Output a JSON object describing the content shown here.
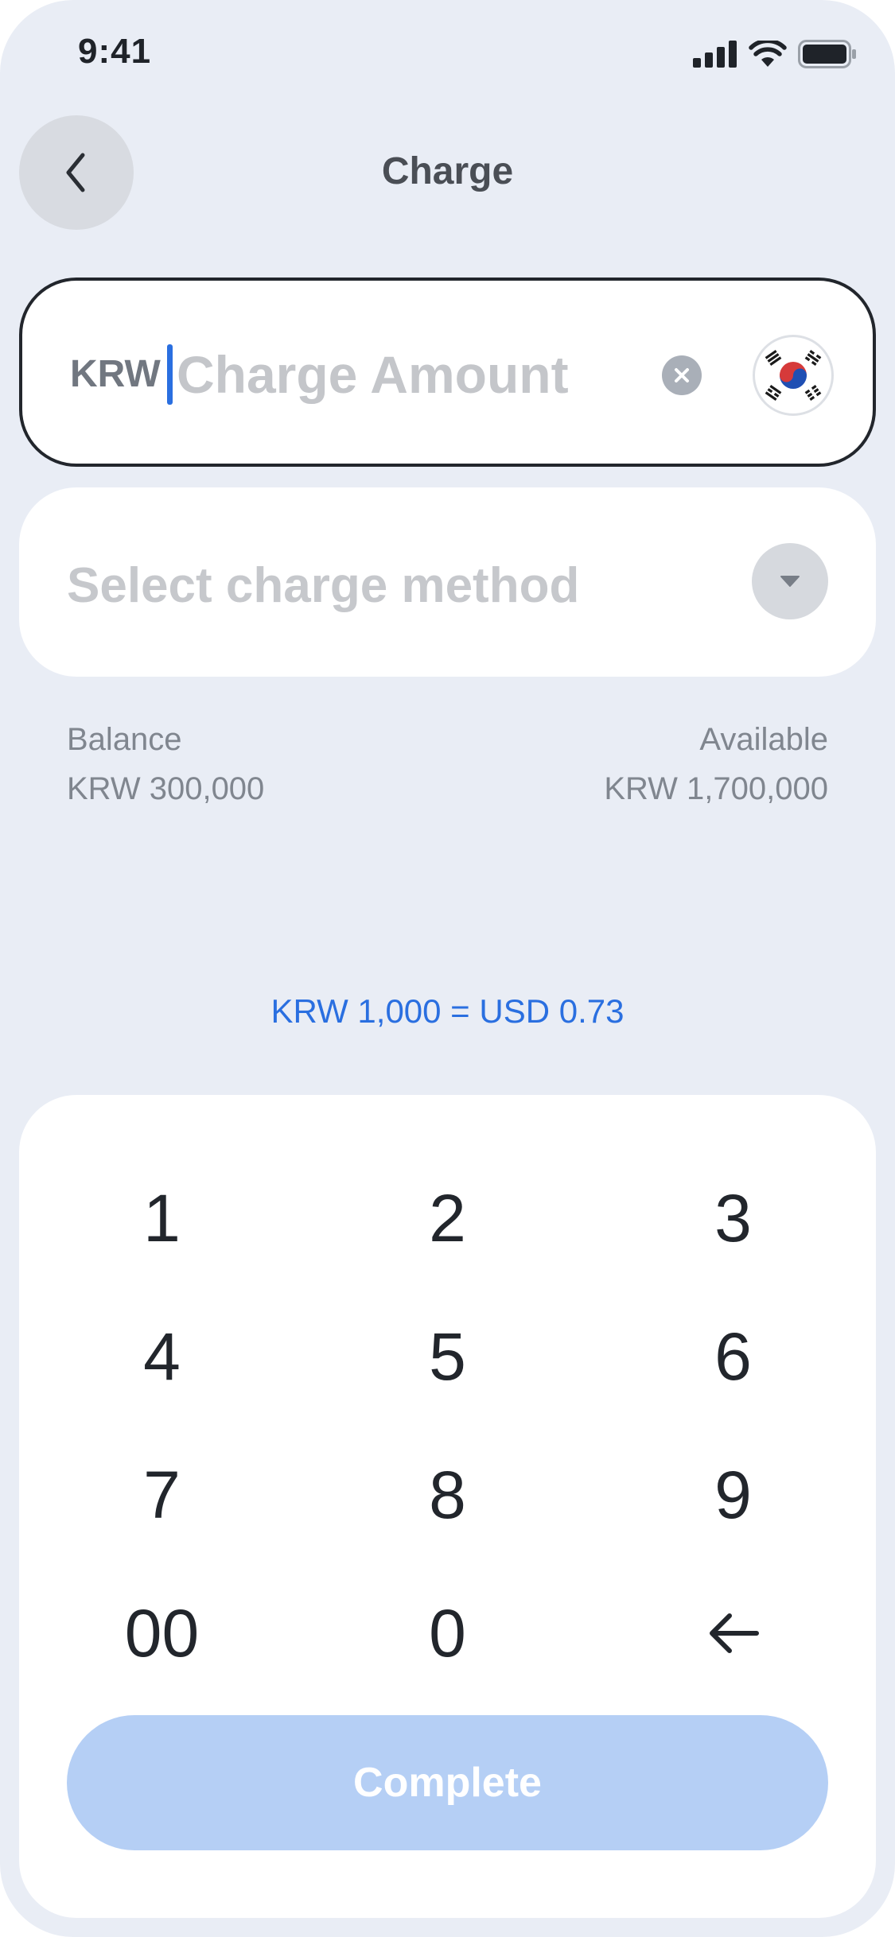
{
  "status_bar": {
    "time": "9:41",
    "icons": [
      "cellular-signal-icon",
      "wifi-icon",
      "battery-icon"
    ]
  },
  "header": {
    "title": "Charge",
    "back_icon": "chevron-left-icon"
  },
  "amount_field": {
    "currency": "KRW",
    "placeholder": "Charge Amount",
    "clear_icon": "clear-icon",
    "flag_icon": "south-korea-flag-icon"
  },
  "method_select": {
    "placeholder": "Select charge method",
    "dropdown_icon": "caret-down-icon"
  },
  "balance": {
    "label": "Balance",
    "value": "KRW 300,000"
  },
  "available": {
    "label": "Available",
    "value": "KRW 1,700,000"
  },
  "exchange_rate": "KRW 1,000 = USD 0.73",
  "keypad": {
    "keys": [
      "1",
      "2",
      "3",
      "4",
      "5",
      "6",
      "7",
      "8",
      "9",
      "00",
      "0"
    ],
    "backspace_icon": "backspace-arrow-icon"
  },
  "complete_button": "Complete",
  "colors": {
    "accent": "#2a6fe0",
    "background": "#e9edf5",
    "button_disabled": "#b5cff5"
  }
}
